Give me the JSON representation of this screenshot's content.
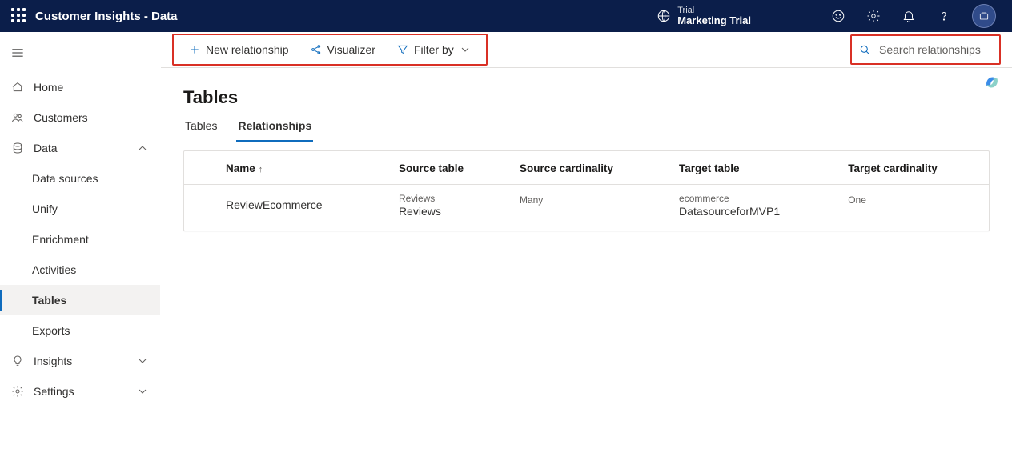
{
  "header": {
    "app_title": "Customer Insights - Data",
    "trial_label": "Trial",
    "trial_name": "Marketing Trial"
  },
  "sidebar": {
    "items": [
      {
        "label": "Home"
      },
      {
        "label": "Customers"
      },
      {
        "label": "Data",
        "expanded": true
      },
      {
        "label": "Insights"
      },
      {
        "label": "Settings"
      }
    ],
    "data_children": [
      {
        "label": "Data sources"
      },
      {
        "label": "Unify"
      },
      {
        "label": "Enrichment"
      },
      {
        "label": "Activities"
      },
      {
        "label": "Tables",
        "active": true
      },
      {
        "label": "Exports"
      }
    ]
  },
  "commandbar": {
    "new_relationship": "New relationship",
    "visualizer": "Visualizer",
    "filter_by": "Filter by",
    "search_placeholder": "Search relationships"
  },
  "page": {
    "title": "Tables",
    "tabs": [
      {
        "label": "Tables"
      },
      {
        "label": "Relationships",
        "active": true
      }
    ],
    "table": {
      "columns": {
        "name": "Name",
        "source_table": "Source table",
        "source_cardinality": "Source cardinality",
        "target_table": "Target table",
        "target_cardinality": "Target cardinality"
      },
      "rows": [
        {
          "name": "ReviewEcommerce",
          "source_sub": "Reviews",
          "source_main": "Reviews",
          "source_cardinality": "Many",
          "target_sub": "ecommerce",
          "target_main": "DatasourceforMVP1",
          "target_cardinality": "One"
        }
      ]
    }
  }
}
